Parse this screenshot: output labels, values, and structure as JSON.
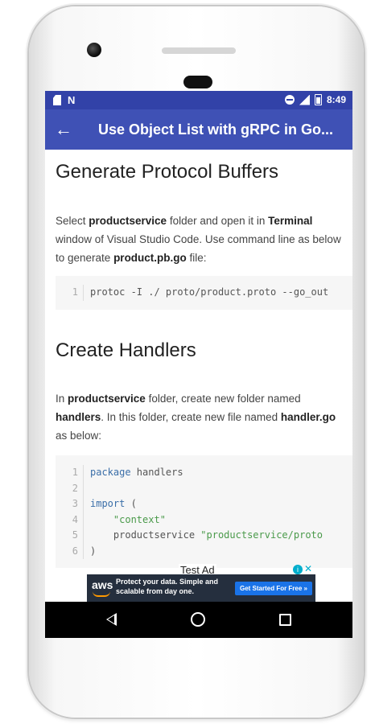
{
  "status_bar": {
    "time": "8:49"
  },
  "app_bar": {
    "title": "Use Object List with gRPC in Go..."
  },
  "content": {
    "section1": {
      "title": "Generate Protocol Buffers",
      "p1": "Select ",
      "b1": "productservice",
      "p2": " folder and open it in ",
      "b2": "Terminal",
      "p3": " window of Visual Studio Code. Use command line as below to generate ",
      "b3": "product.pb.go",
      "p4": " file:",
      "code": [
        {
          "n": "1",
          "text": "protoc -I ./ proto/product.proto --go_out"
        }
      ]
    },
    "section2": {
      "title": "Create Handlers",
      "p1": "In ",
      "b1": "productservice",
      "p2": " folder, create new folder named ",
      "b2": "handlers",
      "p3": ". In this folder, create new file named ",
      "b3": "handler.go",
      "p4": " as below:",
      "code": [
        {
          "n": "1",
          "kw": "package",
          "rest": " handlers"
        },
        {
          "n": "2",
          "kw": "",
          "rest": ""
        },
        {
          "n": "3",
          "kw": "import",
          "rest": " ("
        },
        {
          "n": "4",
          "str": "\"context\""
        },
        {
          "n": "5",
          "pre": "productservice ",
          "str": "\"productservice/proto"
        },
        {
          "n": "6",
          "kw": "",
          "rest": ")"
        }
      ]
    }
  },
  "ad": {
    "label": "Test Ad",
    "logo": "aws",
    "text": "Protect your data. Simple and scalable from day one.",
    "cta": "Get Started For Free »"
  },
  "colors": {
    "status_bar": "#3242a8",
    "app_bar": "#3f51b5",
    "ad_bg": "#252f3e",
    "cta": "#1a73e8"
  },
  "icons": {
    "status_left": [
      "sd-card-icon",
      "n-icon"
    ],
    "status_right": [
      "dnd-icon",
      "signal-icon",
      "battery-icon"
    ],
    "nav": [
      "nav-back-icon",
      "nav-home-icon",
      "nav-recents-icon"
    ]
  }
}
